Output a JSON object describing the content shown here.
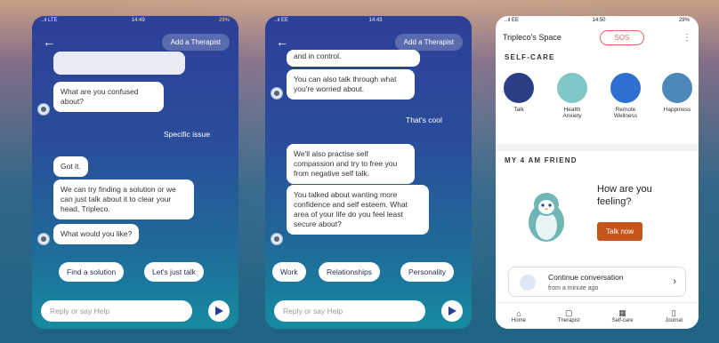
{
  "screen1": {
    "status_left": "..ıl LTE",
    "status_time": "14:49",
    "status_right": "29%",
    "add_therapist": "Add a Therapist",
    "faded_top": "",
    "faded_time": "",
    "msgs": [
      "What are you confused about?",
      "Got it.",
      "We can try finding a solution or we can just talk about it to clear your head, Tripleco.",
      "What would you like?"
    ],
    "user_reply": "Specific issue",
    "chips": [
      "Find a solution",
      "Let's just talk"
    ],
    "input_placeholder": "Reply or say Help"
  },
  "screen2": {
    "status_left": "..ıl EE",
    "status_time": "14:43",
    "status_right": "",
    "add_therapist": "Add a Therapist",
    "msg_top": "and in control.",
    "msgs": [
      "You can also talk through what you're worried about.",
      "We'll also practise self compassion and try to free you from negative self talk.",
      "You talked about wanting more confidence and self esteem. What area of your life do you feel least secure about?"
    ],
    "user_reply": "That's cool",
    "chips": [
      "Work",
      "Relationships",
      "Personality"
    ],
    "input_placeholder": "Reply or say Help"
  },
  "screen3": {
    "status_left": "..ıl EE",
    "status_time": "14:50",
    "status_right": "29%",
    "title": "Tripleco's Space",
    "sos": "SOS",
    "selfcare_title": "SELF-CARE",
    "selfcare": [
      {
        "label": "Talk",
        "color": "#2d3d86"
      },
      {
        "label": "Health Anxiety",
        "color": "#7fc8c7"
      },
      {
        "label": "Remote Wellness",
        "color": "#2f6fd1"
      },
      {
        "label": "Happiness",
        "color": "#4c88b9"
      }
    ],
    "friend_title": "MY 4 AM FRIEND",
    "question": "How are you feeling?",
    "talk_now": "Talk now",
    "continue_title": "Continue conversation",
    "continue_sub": "from a minute ago",
    "nav": [
      {
        "label": "Home",
        "icon": "⌂"
      },
      {
        "label": "Therapist",
        "icon": "▢"
      },
      {
        "label": "Self-care",
        "icon": "▦"
      },
      {
        "label": "Journal",
        "icon": "▯"
      }
    ]
  }
}
